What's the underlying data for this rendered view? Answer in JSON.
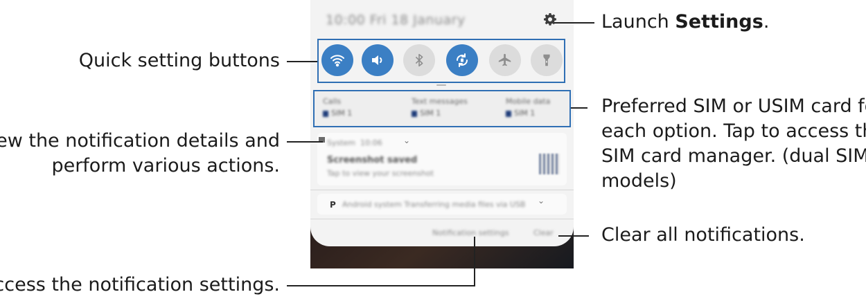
{
  "callouts": {
    "settings_prefix": "Launch ",
    "settings_bold": "Settings",
    "settings_suffix": ".",
    "quick_settings": "Quick setting buttons",
    "sim_line1": "Preferred SIM or USIM card for",
    "sim_line2": "each option. Tap to access the",
    "sim_line3": "SIM card manager. (dual SIM",
    "sim_line4": "models)",
    "notif_line1": "View the notification details and",
    "notif_line2": "perform various actions.",
    "clear": "Clear all notifications.",
    "notif_settings": "Access the notification settings."
  },
  "phone": {
    "status": "10:00  Fri 18 January",
    "quick_buttons": [
      {
        "icon": "wifi-icon",
        "state": "on"
      },
      {
        "icon": "sound-icon",
        "state": "on"
      },
      {
        "icon": "bluetooth-icon",
        "state": "off"
      },
      {
        "icon": "auto-rotate-icon",
        "state": "on"
      },
      {
        "icon": "airplane-mode-icon",
        "state": "off"
      },
      {
        "icon": "flashlight-icon",
        "state": "off"
      }
    ],
    "sim": [
      {
        "title": "Calls",
        "sim": "SIM 1"
      },
      {
        "title": "Text messages",
        "sim": "SIM 1"
      },
      {
        "title": "Mobile data",
        "sim": "SIM 1"
      }
    ],
    "notification": {
      "app": "System",
      "time": "10:06",
      "title": "Screenshot saved",
      "body": "Tap to view your screenshot"
    },
    "notification2": "Android system   Transferring media files via USB",
    "notification_settings": "Notification settings",
    "clear": "Clear"
  },
  "colors": {
    "accent": "#3b7fc4",
    "highlight_border": "#2f6fb4"
  }
}
